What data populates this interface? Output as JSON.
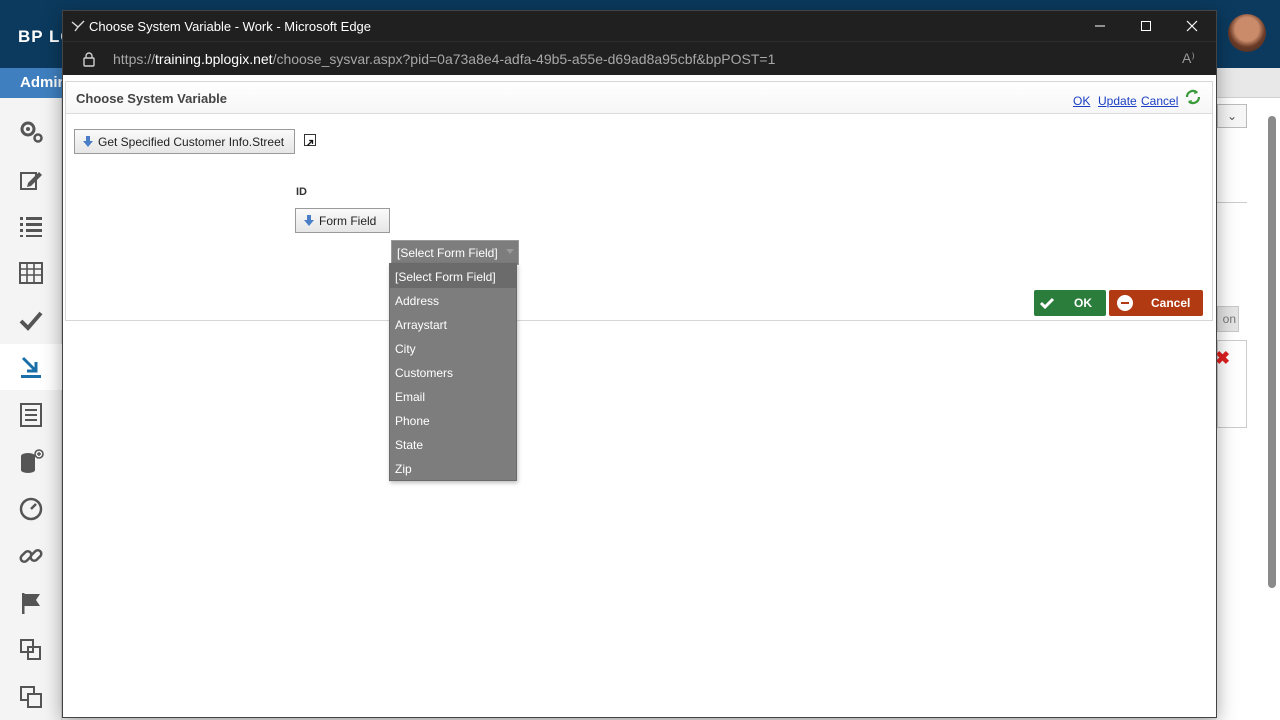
{
  "background": {
    "logo": "BP LO",
    "admin_tab": "Admin",
    "right_select_glyph": "⌄",
    "right_button_text": "on",
    "right_x": "✖",
    "sidebar_icons": [
      "gears-icon",
      "edit-icon",
      "list-icon",
      "table-icon",
      "check-icon",
      "download-icon",
      "report-icon",
      "database-add-icon",
      "dashboard-icon",
      "link-icon",
      "flag-icon",
      "copy-icon",
      "copy-alt-icon"
    ]
  },
  "browser": {
    "title": "Choose System Variable - Work - Microsoft Edge",
    "url_prefix": "https://",
    "url_host": "training.bplogix.net",
    "url_path": "/choose_sysvar.aspx?pid=0a73a8e4-adfa-49b5-a55e-d69ad8a95cbf&bpPOST=1",
    "read_aloud_glyph": "A⁾"
  },
  "dialog": {
    "title": "Choose System Variable",
    "links": {
      "ok": "OK",
      "update": "Update",
      "cancel": "Cancel"
    },
    "source_button": "Get Specified Customer Info.Street",
    "param_label": "ID",
    "param_button": "Form Field",
    "select_value": "[Select Form Field]",
    "ok_button": "OK",
    "cancel_button": "Cancel"
  },
  "dropdown": {
    "options": [
      "[Select Form Field]",
      "Address",
      "Arraystart",
      "City",
      "Customers",
      "Email",
      "Phone",
      "State",
      "Zip"
    ]
  },
  "colors": {
    "ok_green": "#2a7d3a",
    "cancel_red": "#b23a12",
    "link_blue": "#1a3fc4",
    "dropdown_gray": "#7d7d7d"
  }
}
